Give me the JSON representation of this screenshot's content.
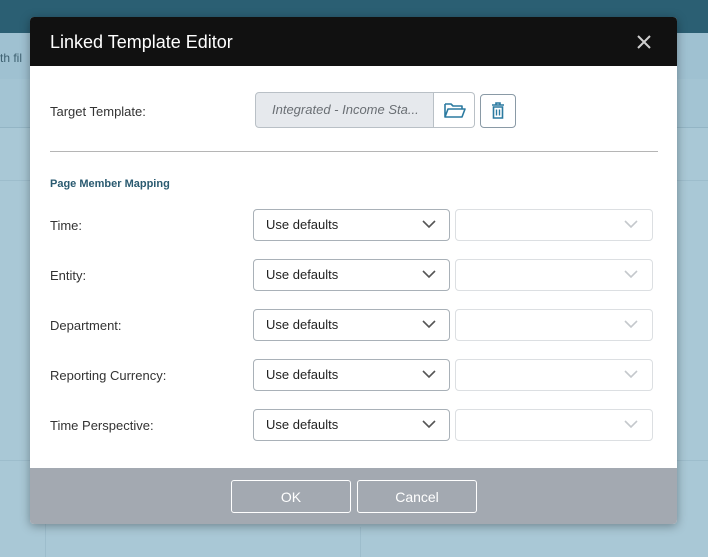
{
  "background": {
    "toolbar_fragment": "th fil"
  },
  "dialog": {
    "title": "Linked Template Editor",
    "target_template_label": "Target Template:",
    "target_template_value": "Integrated - Income Sta...",
    "section_title": "Page Member Mapping",
    "rows": [
      {
        "label": "Time:",
        "select_value": "Use defaults"
      },
      {
        "label": "Entity:",
        "select_value": "Use defaults"
      },
      {
        "label": "Department:",
        "select_value": "Use defaults"
      },
      {
        "label": "Reporting Currency:",
        "select_value": "Use defaults"
      },
      {
        "label": "Time Perspective:",
        "select_value": "Use defaults"
      }
    ],
    "ok_label": "OK",
    "cancel_label": "Cancel"
  },
  "icons": {
    "close": "close-icon",
    "browse": "folder-open-icon",
    "delete": "trash-icon",
    "dropdown": "chevron-down-icon"
  },
  "colors": {
    "header_bg": "#111111",
    "footer_bg": "#a3a9b1",
    "accent": "#2b7aa0",
    "section_title": "#2a5a70"
  }
}
